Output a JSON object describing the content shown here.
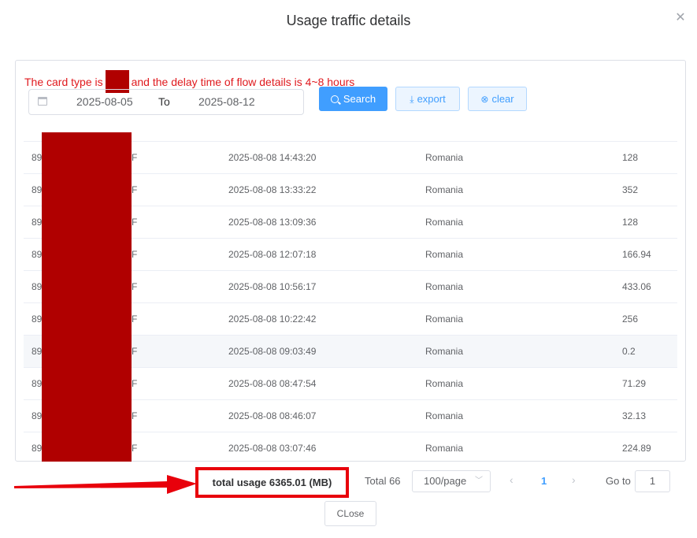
{
  "dialog": {
    "title": "Usage traffic details"
  },
  "notice": {
    "prefix": "The card type is",
    "suffix": "and the delay time of flow details is 4~8 hours"
  },
  "date_range": {
    "start": "2025-08-05",
    "separator": "To",
    "end": "2025-08-12"
  },
  "buttons": {
    "search": "Search",
    "export": "export",
    "clear": "clear",
    "close": "CLose"
  },
  "rows": [
    {
      "id_prefix": "89",
      "id_suffix": "F",
      "time": "2025-08-08 14:43:20",
      "country": "Romania",
      "usage": "128"
    },
    {
      "id_prefix": "89",
      "id_suffix": "F",
      "time": "2025-08-08 13:33:22",
      "country": "Romania",
      "usage": "352"
    },
    {
      "id_prefix": "89",
      "id_suffix": "F",
      "time": "2025-08-08 13:09:36",
      "country": "Romania",
      "usage": "128"
    },
    {
      "id_prefix": "89",
      "id_suffix": "F",
      "time": "2025-08-08 12:07:18",
      "country": "Romania",
      "usage": "166.94"
    },
    {
      "id_prefix": "89",
      "id_suffix": "F",
      "time": "2025-08-08 10:56:17",
      "country": "Romania",
      "usage": "433.06"
    },
    {
      "id_prefix": "89",
      "id_suffix": "F",
      "time": "2025-08-08 10:22:42",
      "country": "Romania",
      "usage": "256"
    },
    {
      "id_prefix": "89",
      "id_suffix": "F",
      "time": "2025-08-08 09:03:49",
      "country": "Romania",
      "usage": "0.2"
    },
    {
      "id_prefix": "89",
      "id_suffix": "F",
      "time": "2025-08-08 08:47:54",
      "country": "Romania",
      "usage": "71.29"
    },
    {
      "id_prefix": "89",
      "id_suffix": "F",
      "time": "2025-08-08 08:46:07",
      "country": "Romania",
      "usage": "32.13"
    },
    {
      "id_prefix": "89",
      "id_suffix": "F",
      "time": "2025-08-08 03:07:46",
      "country": "Romania",
      "usage": "224.89"
    }
  ],
  "summary": {
    "total_usage": "total usage 6365.01 (MB)"
  },
  "pagination": {
    "total": "Total 66",
    "page_size": "100/page",
    "current_page": "1",
    "goto_label": "Go to",
    "goto_value": "1"
  },
  "icons": {
    "close": "close-icon",
    "calendar": "calendar-icon",
    "search": "search-icon",
    "export": "download-icon",
    "clear": "clear-circle-icon"
  },
  "colors": {
    "accent": "#409eff",
    "warning_text": "#e0191e",
    "redaction": "#b00000",
    "annotation": "#e8000b"
  }
}
